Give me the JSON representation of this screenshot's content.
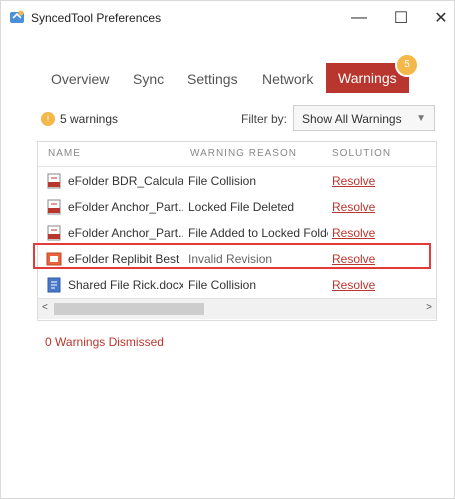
{
  "window": {
    "title": "SyncedTool Preferences",
    "controls": {
      "minimize": "—",
      "maximize": "☐",
      "close": "✕"
    }
  },
  "tabs": [
    {
      "label": "Overview"
    },
    {
      "label": "Sync"
    },
    {
      "label": "Settings"
    },
    {
      "label": "Network"
    },
    {
      "label": "Warnings",
      "active": true,
      "badge": "5"
    }
  ],
  "toolbar": {
    "warning_icon": "!",
    "warning_count": "5 warnings",
    "filter_label": "Filter by:",
    "filter_value": "Show All Warnings"
  },
  "table": {
    "columns": {
      "name": "NAME",
      "reason": "WARNING REASON",
      "solution": "SOLUTION"
    },
    "rows": [
      {
        "name": "eFolder BDR_Calcula...",
        "reason": "File Collision",
        "solution": "Resolve",
        "icon": "pdf-icon"
      },
      {
        "name": "eFolder Anchor_Part...",
        "reason": "Locked File Deleted",
        "solution": "Resolve",
        "icon": "pdf-icon"
      },
      {
        "name": "eFolder Anchor_Part...",
        "reason": "File Added to Locked Folder",
        "solution": "Resolve",
        "icon": "pdf-icon"
      },
      {
        "name": "eFolder Replibit Best ...",
        "reason": "Invalid Revision",
        "solution": "Resolve",
        "icon": "presentation-icon",
        "highlighted": true
      },
      {
        "name": "Shared File Rick.docx",
        "reason": "File Collision",
        "solution": "Resolve",
        "icon": "doc-icon"
      }
    ]
  },
  "footer": {
    "dismissed": "0 Warnings Dismissed"
  },
  "colors": {
    "accent": "#b8362e",
    "badge": "#f4b84a",
    "highlight": "#e33a3a"
  }
}
